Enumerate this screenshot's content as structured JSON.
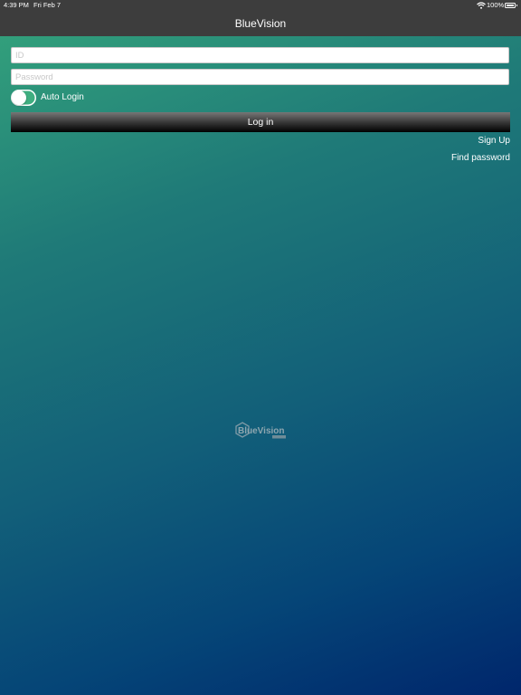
{
  "status_bar": {
    "time": "4:39 PM",
    "date": "Fri Feb 7",
    "battery": "100%",
    "icons": [
      "wifi-icon",
      "battery-icon"
    ]
  },
  "nav": {
    "title": "BlueVision"
  },
  "form": {
    "id_placeholder": "ID",
    "id_value": "",
    "password_placeholder": "Password",
    "password_value": "",
    "auto_login_label": "Auto Login",
    "auto_login_on": false,
    "login_label": "Log in"
  },
  "links": {
    "sign_up": "Sign Up",
    "find_password": "Find password"
  },
  "logo": {
    "text": "BlueVision"
  },
  "colors": {
    "bar": "#3d3d3d",
    "gradient_top": "#35a57c",
    "gradient_bottom": "#00266c",
    "toggle_track": "#3fae80"
  }
}
